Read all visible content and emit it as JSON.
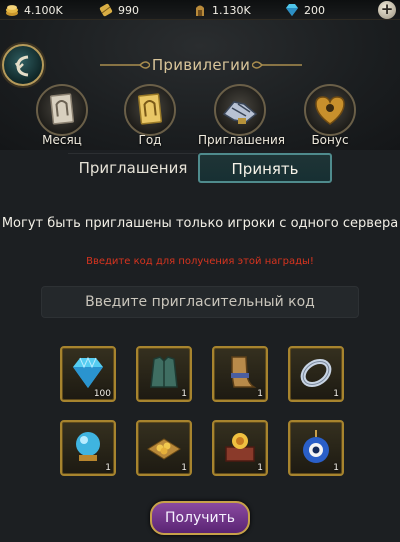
{
  "resources": [
    {
      "icon": "gold-coins-icon",
      "value": "4.100K"
    },
    {
      "icon": "scroll-icon",
      "value": "990"
    },
    {
      "icon": "crown-icon",
      "value": "1.130K"
    },
    {
      "icon": "diamond-icon",
      "value": "200"
    }
  ],
  "header": {
    "title": "Привилегии",
    "tabs": [
      {
        "label": "Месяц",
        "icon": "monthly-card-icon"
      },
      {
        "label": "Год",
        "icon": "yearly-card-icon"
      },
      {
        "label": "Приглашения",
        "icon": "handshake-icon"
      },
      {
        "label": "Бонус",
        "icon": "bonus-emblem-icon"
      }
    ]
  },
  "segment": {
    "invites_label": "Приглашения",
    "accept_label": "Принять",
    "active": "accept"
  },
  "info_text": "Могут быть приглашены только игроки с одного сервера",
  "warning_text": "Введите код для получения этой награды!",
  "code_input": {
    "placeholder": "Введите пригласительный код",
    "value": ""
  },
  "rewards": [
    {
      "icon": "diamond-icon",
      "qty": "100"
    },
    {
      "icon": "vest-armor-icon",
      "qty": "1"
    },
    {
      "icon": "leg-armor-icon",
      "qty": "1"
    },
    {
      "icon": "ring-icon",
      "qty": "1"
    },
    {
      "icon": "crystal-ball-icon",
      "qty": "1"
    },
    {
      "icon": "gold-pile-icon",
      "qty": "1"
    },
    {
      "icon": "treasure-box-icon",
      "qty": "1"
    },
    {
      "icon": "evil-eye-amulet-icon",
      "qty": "1"
    }
  ],
  "receive_label": "Получить",
  "colors": {
    "accent_gold": "#b59a5a",
    "active_tab": "#4f8b8d",
    "warning": "#d8341f",
    "button_purple": "#6e3188"
  }
}
